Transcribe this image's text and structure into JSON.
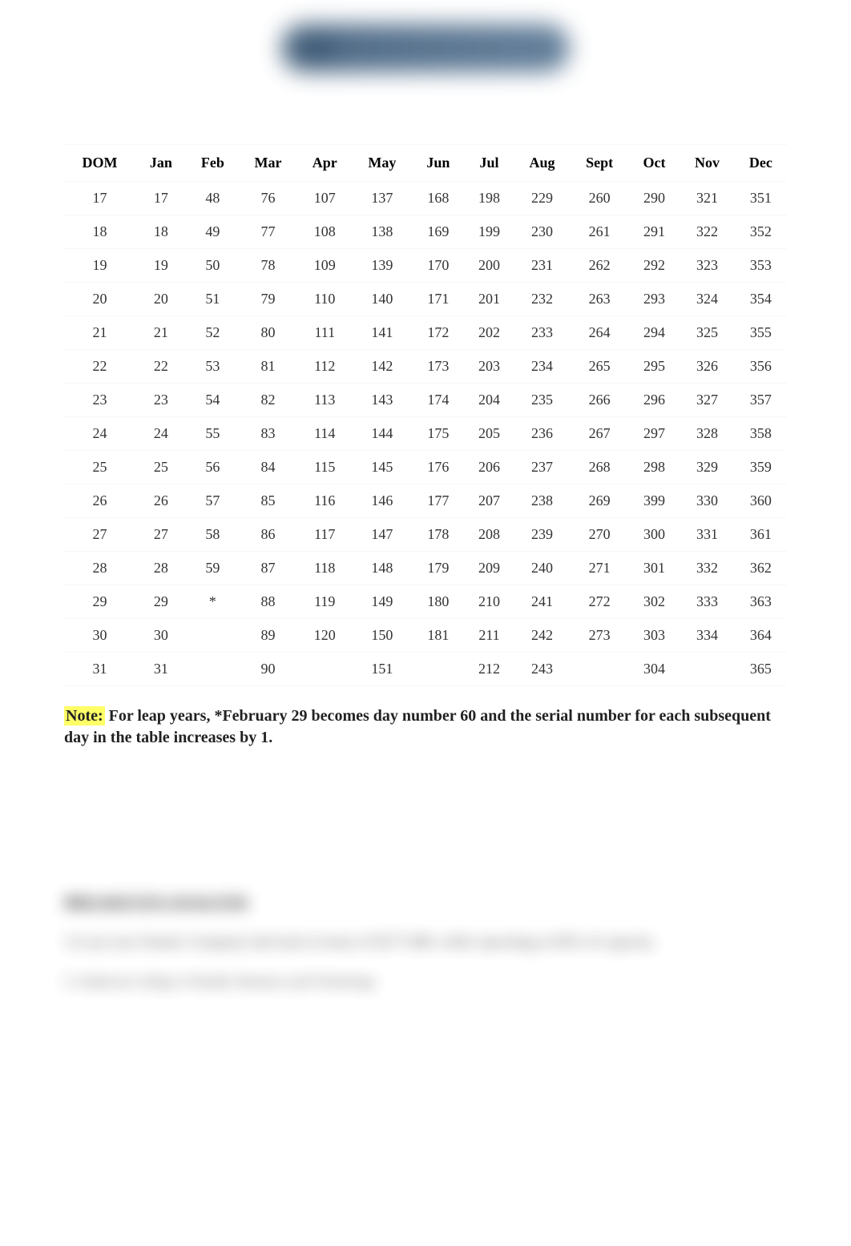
{
  "table": {
    "headers": [
      "DOM",
      "Jan",
      "Feb",
      "Mar",
      "Apr",
      "May",
      "Jun",
      "Jul",
      "Aug",
      "Sept",
      "Oct",
      "Nov",
      "Dec"
    ],
    "rows": [
      [
        "17",
        "17",
        "48",
        "76",
        "107",
        "137",
        "168",
        "198",
        "229",
        "260",
        "290",
        "321",
        "351"
      ],
      [
        "18",
        "18",
        "49",
        "77",
        "108",
        "138",
        "169",
        "199",
        "230",
        "261",
        "291",
        "322",
        "352"
      ],
      [
        "19",
        "19",
        "50",
        "78",
        "109",
        "139",
        "170",
        "200",
        "231",
        "262",
        "292",
        "323",
        "353"
      ],
      [
        "20",
        "20",
        "51",
        "79",
        "110",
        "140",
        "171",
        "201",
        "232",
        "263",
        "293",
        "324",
        "354"
      ],
      [
        "21",
        "21",
        "52",
        "80",
        "111",
        "141",
        "172",
        "202",
        "233",
        "264",
        "294",
        "325",
        "355"
      ],
      [
        "22",
        "22",
        "53",
        "81",
        "112",
        "142",
        "173",
        "203",
        "234",
        "265",
        "295",
        "326",
        "356"
      ],
      [
        "23",
        "23",
        "54",
        "82",
        "113",
        "143",
        "174",
        "204",
        "235",
        "266",
        "296",
        "327",
        "357"
      ],
      [
        "24",
        "24",
        "55",
        "83",
        "114",
        "144",
        "175",
        "205",
        "236",
        "267",
        "297",
        "328",
        "358"
      ],
      [
        "25",
        "25",
        "56",
        "84",
        "115",
        "145",
        "176",
        "206",
        "237",
        "268",
        "298",
        "329",
        "359"
      ],
      [
        "26",
        "26",
        "57",
        "85",
        "116",
        "146",
        "177",
        "207",
        "238",
        "269",
        "399",
        "330",
        "360"
      ],
      [
        "27",
        "27",
        "58",
        "86",
        "117",
        "147",
        "178",
        "208",
        "239",
        "270",
        "300",
        "331",
        "361"
      ],
      [
        "28",
        "28",
        "59",
        "87",
        "118",
        "148",
        "179",
        "209",
        "240",
        "271",
        "301",
        "332",
        "362"
      ],
      [
        "29",
        "29",
        "*",
        "88",
        "119",
        "149",
        "180",
        "210",
        "241",
        "272",
        "302",
        "333",
        "363"
      ],
      [
        "30",
        "30",
        "",
        "89",
        "120",
        "150",
        "181",
        "211",
        "242",
        "273",
        "303",
        "334",
        "364"
      ],
      [
        "31",
        "31",
        "",
        "90",
        "",
        "151",
        "",
        "212",
        "243",
        "",
        "304",
        "",
        "365"
      ]
    ]
  },
  "note": {
    "highlight": "Note:",
    "rest": " For leap years, *February 29 becomes day number 60 and the serial number for each subsequent day in the table increases by 1."
  },
  "blurred": {
    "heading": "BREAKEVEN ANALYSIS",
    "line": "1) Last year Smoky Company had total revenue of $277,000, while operating at 60% of capacity.",
    "footer": "© Anderson College of Health, Business and Technology"
  }
}
